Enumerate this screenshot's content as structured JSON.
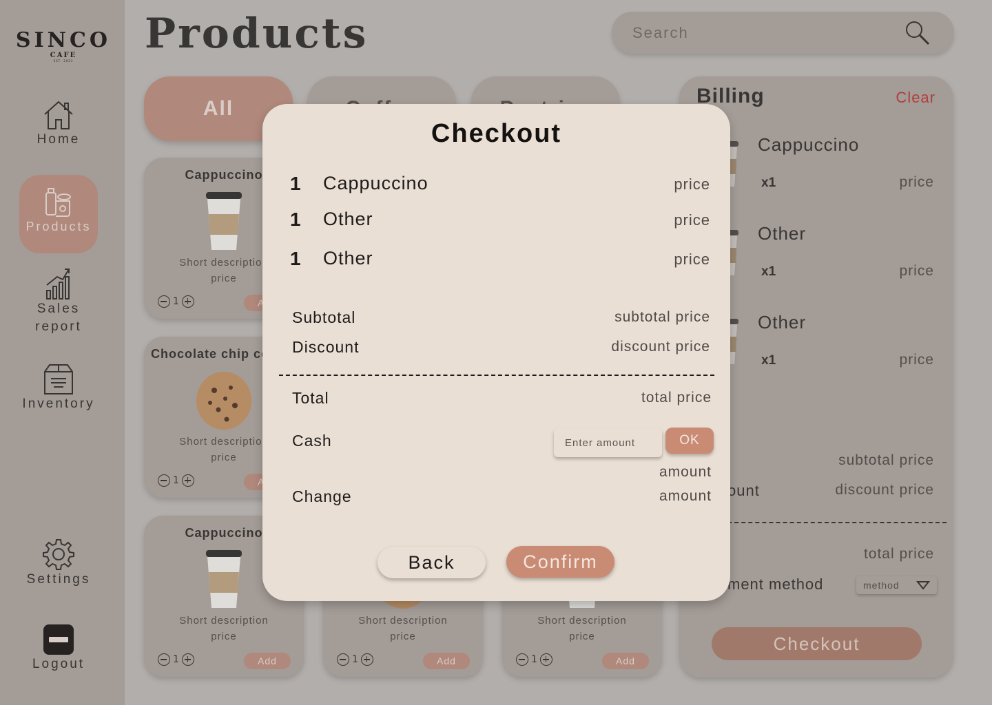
{
  "logo": {
    "name": "SINCO",
    "sub": "CAFE",
    "est": "EST. 2023"
  },
  "sidebar": {
    "items": [
      {
        "label": "Home",
        "icon": "home-icon"
      },
      {
        "label": "Products",
        "icon": "products-icon",
        "active": true
      },
      {
        "label": "Sales",
        "label2": "report",
        "icon": "sales-report-icon"
      },
      {
        "label": "Inventory",
        "icon": "inventory-icon"
      },
      {
        "label": "Settings",
        "icon": "gear-icon"
      },
      {
        "label": "Logout",
        "icon": "logout-icon"
      }
    ]
  },
  "header": {
    "title": "Products",
    "search_placeholder": "Search"
  },
  "tabs": [
    {
      "label": "All",
      "active": true
    },
    {
      "label": "Coffee"
    },
    {
      "label": "Pastries"
    }
  ],
  "products": [
    {
      "name": "Cappuccino",
      "desc": "Short description",
      "price": "price",
      "qty": "1",
      "add": "Add",
      "image": "coffee-cup"
    },
    {
      "name": "Chocolate chip cookie",
      "desc": "Short description",
      "price": "price",
      "qty": "1",
      "add": "Add",
      "image": "cookie"
    },
    {
      "name": "Cappuccino",
      "desc": "Short description",
      "price": "price",
      "qty": "1",
      "add": "Add",
      "image": "coffee-cup"
    },
    {
      "name": "",
      "desc": "Short description",
      "price": "price",
      "qty": "1",
      "add": "Add",
      "image": "cookie"
    },
    {
      "name": "",
      "desc": "Short description",
      "price": "price",
      "qty": "1",
      "add": "Add",
      "image": "coffee-cup"
    }
  ],
  "billing": {
    "title": "Billing",
    "clear": "Clear",
    "items": [
      {
        "name": "Cappuccino",
        "qty": "x1",
        "price": "price"
      },
      {
        "name": "Other",
        "qty": "x1",
        "price": "price"
      },
      {
        "name": "Other",
        "qty": "x1",
        "price": "price"
      }
    ],
    "subtotal_value": "subtotal price",
    "discount_label": "ount",
    "discount_value": "discount price",
    "total_label": "l",
    "total_value": "total price",
    "payment_label": "ment method",
    "payment_select": "method",
    "checkout": "Checkout"
  },
  "checkout_modal": {
    "title": "Checkout",
    "items": [
      {
        "qty": "1",
        "name": "Cappuccino",
        "price": "price"
      },
      {
        "qty": "1",
        "name": "Other",
        "price": "price"
      },
      {
        "qty": "1",
        "name": "Other",
        "price": "price"
      }
    ],
    "subtotal_label": "Subtotal",
    "subtotal_value": "subtotal price",
    "discount_label": "Discount",
    "discount_value": "discount price",
    "total_label": "Total",
    "total_value": "total price",
    "cash_label": "Cash",
    "cash_placeholder": "Enter amount",
    "ok": "OK",
    "cash_amount": "amount",
    "change_label": "Change",
    "change_value": "amount",
    "back": "Back",
    "confirm": "Confirm"
  },
  "colors": {
    "background": "#b5b1ae",
    "panel": "#a59c97",
    "accent": "#b38678",
    "modal": "#eadfd4",
    "danger": "#b3312f"
  }
}
